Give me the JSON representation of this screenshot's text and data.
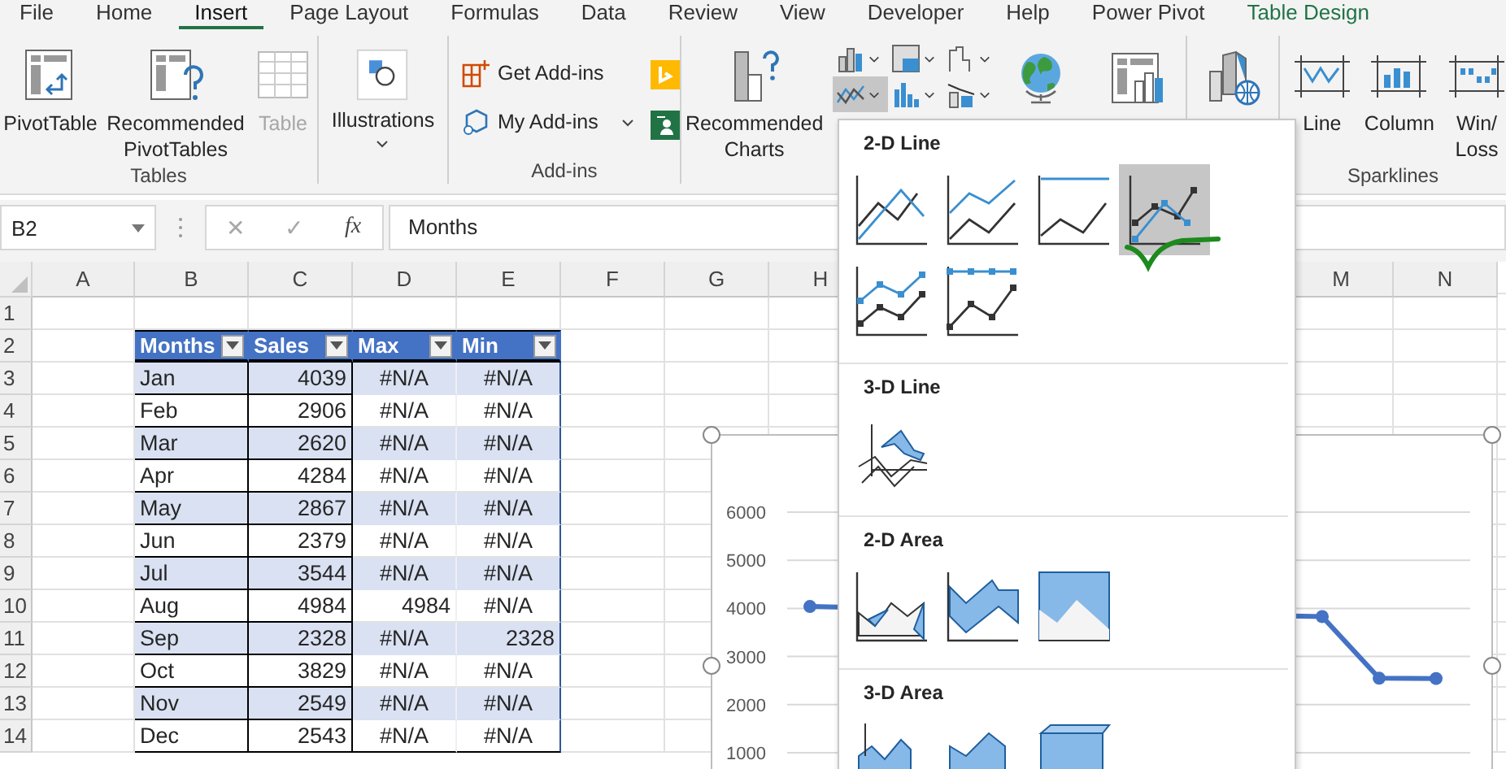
{
  "tabs": [
    {
      "label": "File",
      "selected": false,
      "kind": "standard"
    },
    {
      "label": "Home",
      "selected": false,
      "kind": "standard"
    },
    {
      "label": "Insert",
      "selected": true,
      "kind": "standard"
    },
    {
      "label": "Page Layout",
      "selected": false,
      "kind": "standard"
    },
    {
      "label": "Formulas",
      "selected": false,
      "kind": "standard"
    },
    {
      "label": "Data",
      "selected": false,
      "kind": "standard"
    },
    {
      "label": "Review",
      "selected": false,
      "kind": "standard"
    },
    {
      "label": "View",
      "selected": false,
      "kind": "standard"
    },
    {
      "label": "Developer",
      "selected": false,
      "kind": "standard"
    },
    {
      "label": "Help",
      "selected": false,
      "kind": "standard"
    },
    {
      "label": "Power Pivot",
      "selected": false,
      "kind": "standard"
    },
    {
      "label": "Table Design",
      "selected": false,
      "kind": "contextual"
    }
  ],
  "ribbon": {
    "tables": {
      "label": "Tables",
      "buttons": [
        {
          "label": "PivotTable",
          "disabled": false
        },
        {
          "label": "Recommended PivotTables",
          "disabled": false
        },
        {
          "label": "Table",
          "disabled": true
        }
      ]
    },
    "illustrations": {
      "label": "Illustrations"
    },
    "addins": {
      "label": "Add-ins",
      "buttons": [
        {
          "label": "Get Add-ins"
        },
        {
          "label": "My Add-ins"
        }
      ]
    },
    "charts": {
      "recommended": "Recommended Charts",
      "line_pressed": true
    },
    "sparklines": {
      "label": "Sparklines",
      "buttons": [
        {
          "label": "Line"
        },
        {
          "label": "Column"
        },
        {
          "label": "Win/\nLoss"
        }
      ]
    }
  },
  "formula_bar": {
    "name_box": "B2",
    "cancel": "✕",
    "enter": "✓",
    "function": "fx",
    "content": "Months"
  },
  "sheet": {
    "columns": [
      "A",
      "B",
      "C",
      "D",
      "E",
      "F",
      "G",
      "H"
    ],
    "right_columns": [
      "M",
      "N"
    ],
    "rows": [
      "1",
      "2",
      "3",
      "4",
      "5",
      "6",
      "7",
      "8",
      "9",
      "10",
      "11",
      "12",
      "13",
      "14"
    ],
    "table": {
      "headers": [
        "Months",
        "Sales",
        "Max",
        "Min"
      ],
      "rows": [
        {
          "cells": [
            {
              "text": "Jan",
              "kind": "text"
            },
            {
              "text": "4039",
              "kind": "number"
            },
            {
              "text": "#N/A",
              "kind": "error"
            },
            {
              "text": "#N/A",
              "kind": "error"
            }
          ]
        },
        {
          "cells": [
            {
              "text": "Feb",
              "kind": "text"
            },
            {
              "text": "2906",
              "kind": "number"
            },
            {
              "text": "#N/A",
              "kind": "error"
            },
            {
              "text": "#N/A",
              "kind": "error"
            }
          ]
        },
        {
          "cells": [
            {
              "text": "Mar",
              "kind": "text"
            },
            {
              "text": "2620",
              "kind": "number"
            },
            {
              "text": "#N/A",
              "kind": "error"
            },
            {
              "text": "#N/A",
              "kind": "error"
            }
          ]
        },
        {
          "cells": [
            {
              "text": "Apr",
              "kind": "text"
            },
            {
              "text": "4284",
              "kind": "number"
            },
            {
              "text": "#N/A",
              "kind": "error"
            },
            {
              "text": "#N/A",
              "kind": "error"
            }
          ]
        },
        {
          "cells": [
            {
              "text": "May",
              "kind": "text"
            },
            {
              "text": "2867",
              "kind": "number"
            },
            {
              "text": "#N/A",
              "kind": "error"
            },
            {
              "text": "#N/A",
              "kind": "error"
            }
          ]
        },
        {
          "cells": [
            {
              "text": "Jun",
              "kind": "text"
            },
            {
              "text": "2379",
              "kind": "number"
            },
            {
              "text": "#N/A",
              "kind": "error"
            },
            {
              "text": "#N/A",
              "kind": "error"
            }
          ]
        },
        {
          "cells": [
            {
              "text": "Jul",
              "kind": "text"
            },
            {
              "text": "3544",
              "kind": "number"
            },
            {
              "text": "#N/A",
              "kind": "error"
            },
            {
              "text": "#N/A",
              "kind": "error"
            }
          ]
        },
        {
          "cells": [
            {
              "text": "Aug",
              "kind": "text"
            },
            {
              "text": "4984",
              "kind": "number"
            },
            {
              "text": "4984",
              "kind": "number"
            },
            {
              "text": "#N/A",
              "kind": "error"
            }
          ]
        },
        {
          "cells": [
            {
              "text": "Sep",
              "kind": "text"
            },
            {
              "text": "2328",
              "kind": "number"
            },
            {
              "text": "#N/A",
              "kind": "error"
            },
            {
              "text": "2328",
              "kind": "number"
            }
          ]
        },
        {
          "cells": [
            {
              "text": "Oct",
              "kind": "text"
            },
            {
              "text": "3829",
              "kind": "number"
            },
            {
              "text": "#N/A",
              "kind": "error"
            },
            {
              "text": "#N/A",
              "kind": "error"
            }
          ]
        },
        {
          "cells": [
            {
              "text": "Nov",
              "kind": "text"
            },
            {
              "text": "2549",
              "kind": "number"
            },
            {
              "text": "#N/A",
              "kind": "error"
            },
            {
              "text": "#N/A",
              "kind": "error"
            }
          ]
        },
        {
          "cells": [
            {
              "text": "Dec",
              "kind": "text"
            },
            {
              "text": "2543",
              "kind": "number"
            },
            {
              "text": "#N/A",
              "kind": "error"
            },
            {
              "text": "#N/A",
              "kind": "error"
            }
          ]
        }
      ]
    }
  },
  "chart": {
    "chart_data": {
      "type": "line",
      "ylim": [
        1000,
        6000
      ],
      "yticks": [
        1000,
        2000,
        3000,
        4000,
        5000,
        6000
      ],
      "grid": true,
      "series": [
        {
          "color": "#4472c4",
          "marker": true,
          "values": [
            4039,
            null,
            null,
            null,
            null,
            null,
            null,
            null,
            null,
            3829,
            2549,
            2543
          ]
        }
      ]
    }
  },
  "chart_menu": {
    "sections": [
      {
        "title": "2-D Line",
        "items": [
          {
            "kind": "line",
            "selected": false
          },
          {
            "kind": "stacked-line",
            "selected": false
          },
          {
            "kind": "percent-line",
            "selected": false
          },
          {
            "kind": "line-markers",
            "selected": true
          },
          {
            "kind": "stacked-markers",
            "selected": false
          },
          {
            "kind": "percent-markers",
            "selected": false
          }
        ]
      },
      {
        "title": "3-D Line",
        "items": [
          {
            "kind": "line-3d",
            "selected": false
          }
        ]
      },
      {
        "title": "2-D Area",
        "items": [
          {
            "kind": "area",
            "selected": false
          },
          {
            "kind": "stacked-area",
            "selected": false
          },
          {
            "kind": "percent-area",
            "selected": false
          }
        ]
      },
      {
        "title": "3-D Area",
        "items": [
          {
            "kind": "area-3d",
            "selected": false
          },
          {
            "kind": "stacked-area-3d",
            "selected": false
          },
          {
            "kind": "percent-area-3d",
            "selected": false
          }
        ]
      }
    ]
  }
}
